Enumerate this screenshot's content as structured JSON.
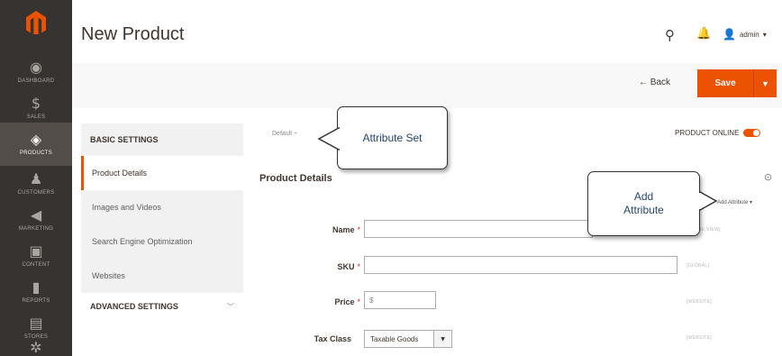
{
  "sidebar": {
    "items": [
      {
        "label": "DASHBOARD",
        "icon": "dashboard-icon",
        "glyph": "◉"
      },
      {
        "label": "SALES",
        "icon": "dollar-icon",
        "glyph": "$"
      },
      {
        "label": "PRODUCTS",
        "icon": "cube-icon",
        "glyph": "◈"
      },
      {
        "label": "CUSTOMERS",
        "icon": "person-icon",
        "glyph": "♟"
      },
      {
        "label": "MARKETING",
        "icon": "megaphone-icon",
        "glyph": "◀"
      },
      {
        "label": "CONTENT",
        "icon": "layout-icon",
        "glyph": "▣"
      },
      {
        "label": "REPORTS",
        "icon": "bar-chart-icon",
        "glyph": "▮"
      },
      {
        "label": "STORES",
        "icon": "store-icon",
        "glyph": "▤"
      },
      {
        "label": "",
        "icon": "gear-icon",
        "glyph": "✲"
      }
    ]
  },
  "header": {
    "title": "New Product",
    "user": "admin",
    "user_caret": "▾",
    "search_glyph": "⚲",
    "bell_glyph": "🔔",
    "user_glyph": "👤"
  },
  "actions": {
    "back": "← Back",
    "save": "Save",
    "save_caret": "▼"
  },
  "tabs": {
    "basic_settings": "BASIC SETTINGS",
    "items": [
      "Product Details",
      "Images and Videos",
      "Search Engine Optimization",
      "Websites"
    ],
    "advanced_settings": "ADVANCED SETTINGS",
    "advanced_chevron": "﹀"
  },
  "form": {
    "attribute_set": "Default ÷",
    "product_online": "PRODUCT ONLINE",
    "section_title": "Product Details",
    "collapse_glyph": "⊙",
    "add_attribute": "Add Attribute ▾",
    "required_mark": "*",
    "name_label": "Name",
    "sku_label": "SKU",
    "price_label": "Price",
    "price_currency": "$",
    "tax_class_label": "Tax Class",
    "tax_class_value": "Taxable Goods",
    "tax_class_arrow": "▼",
    "scope_name": "[STORE VIEW]",
    "scope_sku": "[GLOBAL]",
    "scope_price": "[WEBSITE]",
    "scope_tax": "[WEBSITE]"
  },
  "callouts": {
    "attribute_set": "Attribute Set",
    "add_attribute": "Add\nAttribute"
  },
  "colors": {
    "accent": "#eb5202",
    "sidebar": "#373330",
    "callout_text": "#24466f"
  }
}
